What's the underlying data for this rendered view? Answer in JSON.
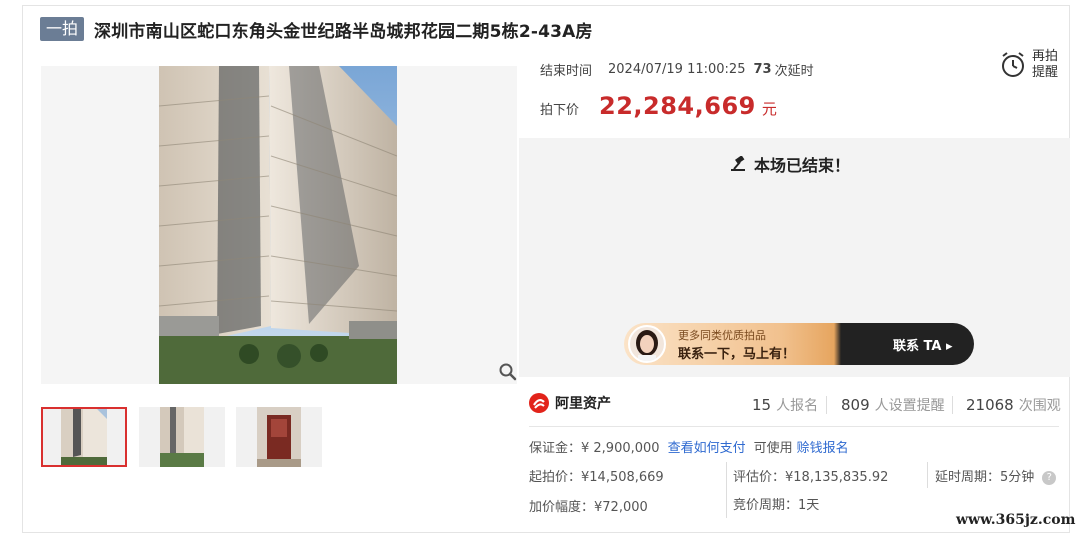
{
  "title": {
    "badge": "一拍",
    "text": "深圳市南山区蛇口东角头金世纪路半岛城邦花园二期5栋2-43A房"
  },
  "auction": {
    "end_label": "结束时间",
    "end_time": "2024/07/19 11:00:25",
    "delay_count": "73",
    "delay_suffix": "次延时",
    "remind_label": "再拍提醒",
    "price_label": "拍下价",
    "price": "22,284,669",
    "price_unit": "元",
    "ended_text": "本场已结束！"
  },
  "ad": {
    "line1": "更多同类优质拍品",
    "line2": "联系一下，马上有！",
    "cta": "联系 TA ▸"
  },
  "brand": {
    "name": "阿里资产"
  },
  "stats": [
    {
      "num": "15",
      "label": "人报名"
    },
    {
      "num": "809",
      "label": "人设置提醒"
    },
    {
      "num": "21068",
      "label": "次围观"
    }
  ],
  "deposit": {
    "label": "保证金：¥ 2,900,000",
    "link1": "查看如何支付",
    "mid": "可使用",
    "link2": "赊钱报名"
  },
  "details": {
    "start_price": "起拍价：¥14,508,669",
    "appraisal": "评估价：¥18,135,835.92",
    "delay_period": "延时周期：5分钟",
    "increment": "加价幅度：¥72,000",
    "bid_period": "竞价周期：1天"
  },
  "watermark": "www.365jz.com",
  "colors": {
    "price": "#c82b2b",
    "link": "#2f6ad0",
    "badge": "#6b7d95",
    "brand": "#e2231a"
  }
}
